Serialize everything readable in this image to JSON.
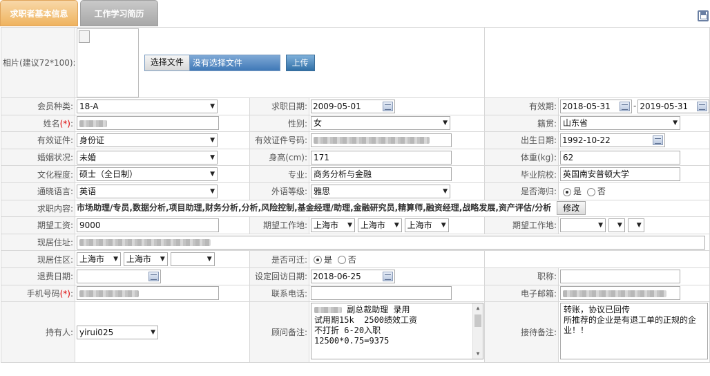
{
  "tabs": {
    "active": "求职者基本信息",
    "inactive": "工作学习简历"
  },
  "photo": {
    "label": "相片(建议72*100):",
    "choose_file": "选择文件",
    "no_file": "没有选择文件",
    "upload": "上传"
  },
  "row1": {
    "member_type_label": "会员种类:",
    "member_type": "18-A",
    "apply_date_label": "求职日期:",
    "apply_date": "2009-05-01",
    "valid_label": "有效期:",
    "valid_from": "2018-05-31",
    "valid_sep": "-",
    "valid_to": "2019-05-31"
  },
  "row2": {
    "name_label": "姓名",
    "req_mark": "(*)",
    "gender_label": "性别:",
    "gender": "女",
    "origin_label": "籍贯:",
    "origin": "山东省"
  },
  "row3": {
    "id_type_label": "有效证件:",
    "id_type": "身份证",
    "id_no_label": "有效证件号码:",
    "birth_label": "出生日期:",
    "birth": "1992-10-22"
  },
  "row4": {
    "marital_label": "婚姻状况:",
    "marital": "未婚",
    "height_label": "身高(cm):",
    "height": "171",
    "weight_label": "体重(kg):",
    "weight": "62"
  },
  "row5": {
    "edu_label": "文化程度:",
    "edu": "硕士（全日制）",
    "major_label": "专业:",
    "major": "商务分析与金融",
    "school_label": "毕业院校:",
    "school": "英国南安普顿大学"
  },
  "row6": {
    "lang_label": "通晓语言:",
    "lang": "英语",
    "foreign_label": "外语等级:",
    "foreign": "雅思",
    "abroad_label": "是否海归:",
    "yes": "是",
    "no": "否"
  },
  "row7": {
    "job_label": "求职内容:",
    "job_content": "市场助理/专员,数据分析,项目助理,财务分析,分析,风险控制,基金经理/助理,金融研究员,精算师,融资经理,战略发展,资产评估/分析",
    "edit": "修改"
  },
  "row8": {
    "salary_label": "期望工资:",
    "salary": "9000",
    "work_place_label": "期望工作地:",
    "place1": "上海市",
    "place2": "上海市",
    "place3": "上海市",
    "work_place2_label": "期望工作地:"
  },
  "row9": {
    "address_label": "现居住址:"
  },
  "row10": {
    "area_label": "现居住区:",
    "area1": "上海市",
    "area2": "上海市",
    "relocate_label": "是否可迁:",
    "yes": "是",
    "no": "否"
  },
  "row11": {
    "refund_label": "退费日期:",
    "visit_label": "设定回访日期:",
    "visit_date": "2018-06-25",
    "title_label": "职称:"
  },
  "row12": {
    "mobile_label": "手机号码",
    "req_mark": "(*)",
    "phone_label": "联系电话:",
    "email_label": "电子邮箱:"
  },
  "row13": {
    "holder_label": "持有人:",
    "holder": "yirui025",
    "advisor_label": "顾问备注:",
    "advisor_note": " 副总裁助理 录用\n试用期15k  2500绩效工资\n不打折 6-20入职\n12500*0.75=9375",
    "reception_label": "接待备注:",
    "reception_note": "转账，协议已回传\n所推荐的企业是有退工单的正规的企业！！"
  }
}
